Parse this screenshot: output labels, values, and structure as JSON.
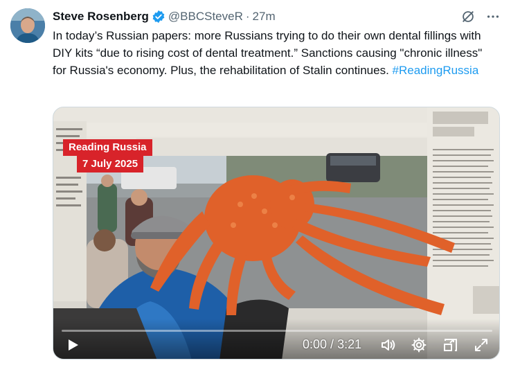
{
  "tweet": {
    "author_name": "Steve Rosenberg",
    "handle": "@BBCSteveR",
    "separator": "·",
    "time": "27m",
    "text_main": "In today’s Russian papers: more Russians trying to do their own dental fillings with DIY kits “due to rising cost of dental treatment.” Sanctions causing \"chronic illness\" for Russia's economy. Plus, the rehabilitation of Stalin continues. ",
    "hashtag": "#ReadingRussia"
  },
  "video": {
    "badge_title": "Reading Russia",
    "badge_date": "7 July 2025",
    "current_time": "0:00",
    "time_separator": " / ",
    "duration": "3:21",
    "progress_fraction": 0.0,
    "icons": [
      "play-icon",
      "volume-icon",
      "settings-icon",
      "picture-in-picture-icon",
      "fullscreen-icon"
    ]
  },
  "colors": {
    "accent": "#1d9bf0",
    "badge_red": "#d8232a",
    "secondary_text": "#536471"
  }
}
